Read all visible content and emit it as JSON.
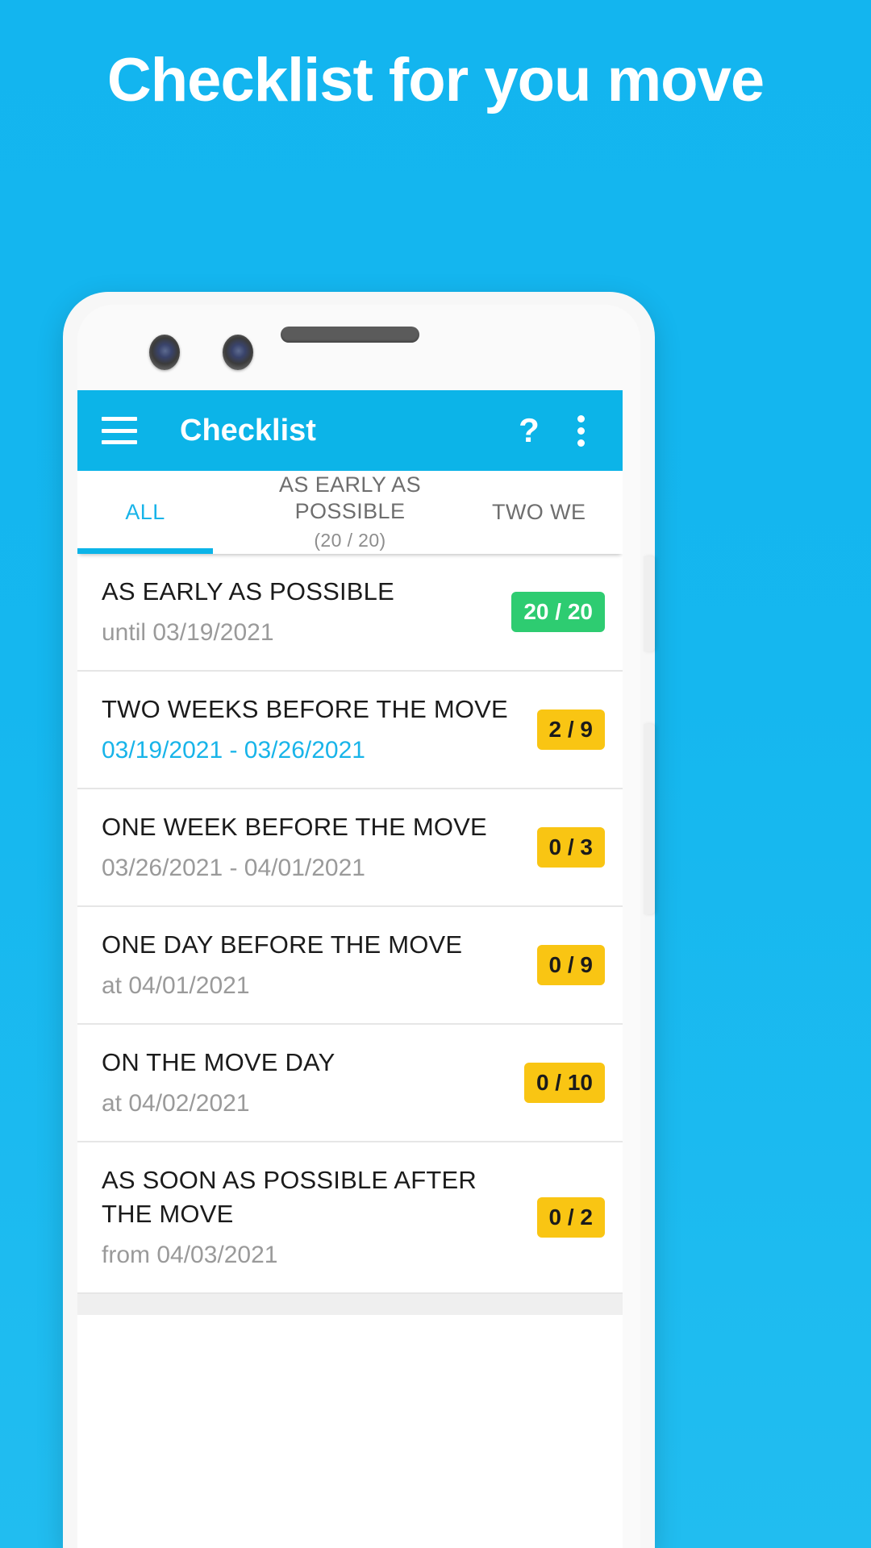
{
  "promo": {
    "headline": "Checklist for you move",
    "background_color": "#15b7ef"
  },
  "app": {
    "bar": {
      "title": "Checklist",
      "menu_icon": "hamburger-menu-icon",
      "help_icon": "?",
      "overflow_icon": "vertical-dots-icon",
      "background_color": "#0cb4e8"
    },
    "tabs": [
      {
        "label": "ALL",
        "count": "",
        "active": true
      },
      {
        "label": "AS EARLY AS POSSIBLE",
        "count": "(20 / 20)",
        "active": false
      },
      {
        "label": "TWO WE",
        "count": "",
        "active": false
      }
    ],
    "list": [
      {
        "title": "AS EARLY AS POSSIBLE",
        "subtitle": "until 03/19/2021",
        "badge": "20 / 20",
        "badge_state": "complete",
        "current": false
      },
      {
        "title": "TWO WEEKS BEFORE THE MOVE",
        "subtitle": "03/19/2021 - 03/26/2021",
        "badge": "2 / 9",
        "badge_state": "pending",
        "current": true
      },
      {
        "title": "ONE WEEK BEFORE THE MOVE",
        "subtitle": "03/26/2021 - 04/01/2021",
        "badge": "0 / 3",
        "badge_state": "pending",
        "current": false
      },
      {
        "title": "ONE DAY BEFORE THE MOVE",
        "subtitle": "at 04/01/2021",
        "badge": "0 / 9",
        "badge_state": "pending",
        "current": false
      },
      {
        "title": "ON THE MOVE DAY",
        "subtitle": "at 04/02/2021",
        "badge": "0 / 10",
        "badge_state": "pending",
        "current": false
      },
      {
        "title": "AS SOON AS POSSIBLE AFTER THE MOVE",
        "subtitle": "from 04/03/2021",
        "badge": "0 / 2",
        "badge_state": "pending",
        "current": false
      }
    ],
    "colors": {
      "accent": "#0cb4e8",
      "complete_badge": "#2ecc71",
      "pending_badge": "#f9c513"
    }
  }
}
